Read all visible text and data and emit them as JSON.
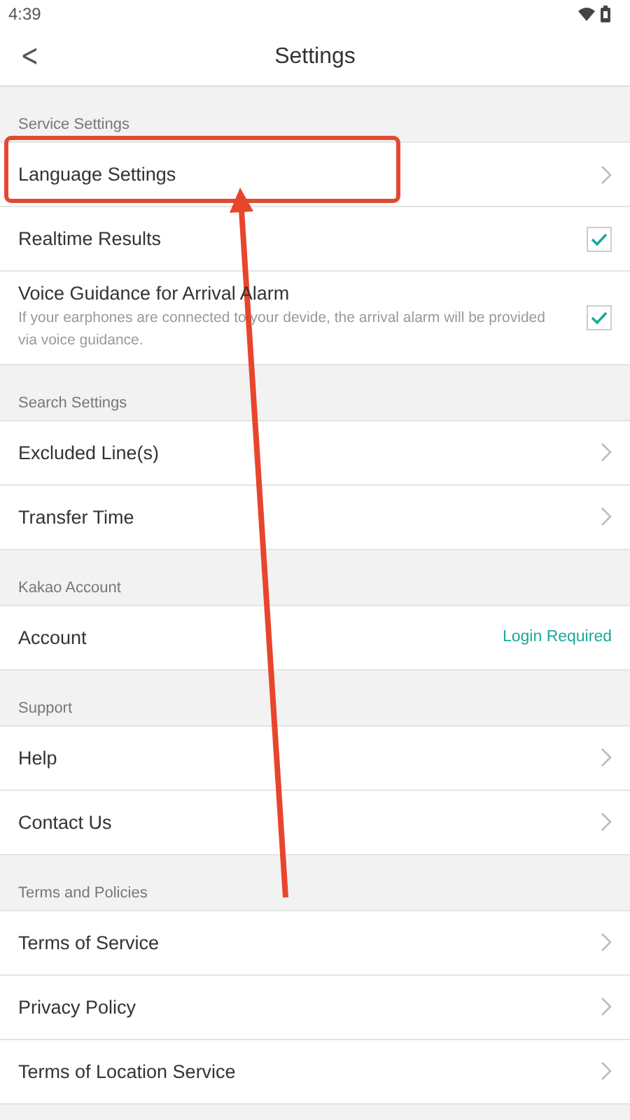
{
  "status_bar": {
    "time": "4:39"
  },
  "header": {
    "back": "<",
    "title": "Settings"
  },
  "sections": [
    {
      "title": "Service Settings",
      "items": [
        {
          "kind": "link",
          "label": "Language Settings",
          "highlighted": true
        },
        {
          "kind": "checkbox",
          "label": "Realtime Results",
          "checked": true
        },
        {
          "kind": "checkbox",
          "label": "Voice Guidance for Arrival Alarm",
          "description": "If your earphones are connected to your devide, the arrival alarm will be provided via voice guidance.",
          "checked": true
        }
      ]
    },
    {
      "title": "Search Settings",
      "items": [
        {
          "kind": "link",
          "label": "Excluded Line(s)"
        },
        {
          "kind": "link",
          "label": "Transfer Time"
        }
      ]
    },
    {
      "title": "Kakao Account",
      "items": [
        {
          "kind": "value",
          "label": "Account",
          "value": "Login Required"
        }
      ]
    },
    {
      "title": "Support",
      "items": [
        {
          "kind": "link",
          "label": "Help"
        },
        {
          "kind": "link",
          "label": "Contact Us"
        }
      ]
    },
    {
      "title": "Terms and Policies",
      "items": [
        {
          "kind": "link",
          "label": "Terms of Service"
        },
        {
          "kind": "link",
          "label": "Privacy Policy"
        },
        {
          "kind": "link",
          "label": "Terms of Location Service"
        }
      ]
    }
  ]
}
